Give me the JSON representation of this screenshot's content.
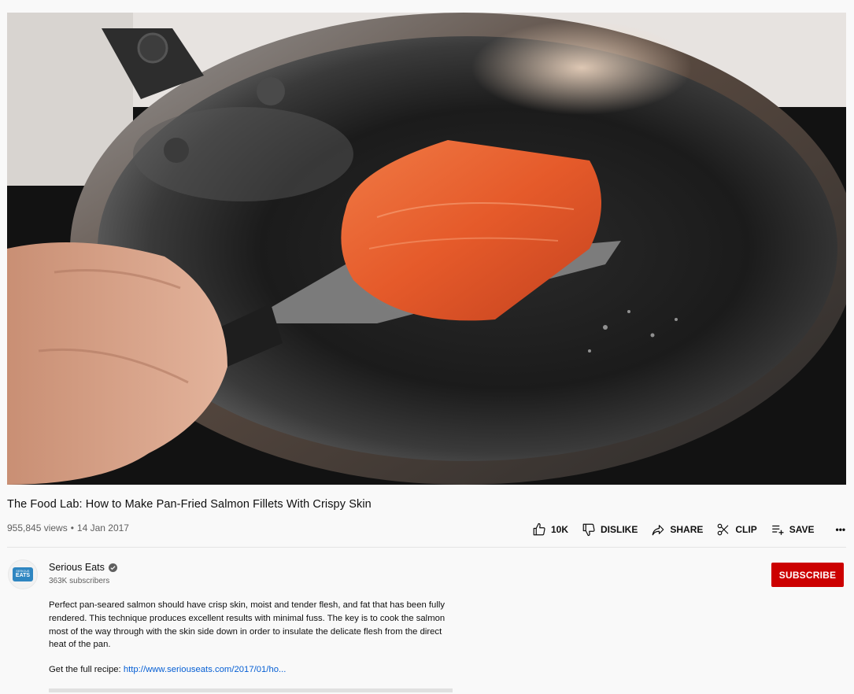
{
  "video": {
    "title": "The Food Lab: How to Make Pan-Fried Salmon Fillets With Crispy Skin",
    "views": "955,845 views",
    "separator": "•",
    "date": "14 Jan 2017"
  },
  "actions": {
    "like_count": "10K",
    "dislike_label": "DISLIKE",
    "share_label": "SHARE",
    "clip_label": "CLIP",
    "save_label": "SAVE",
    "more_label": "•••"
  },
  "channel": {
    "name": "Serious Eats",
    "subscribers": "363K subscribers",
    "avatar_text_top": "SERIOUS",
    "avatar_text_bottom": "EATS",
    "avatar_color": "#2f86c1"
  },
  "subscribe_label": "SUBSCRIBE",
  "description": {
    "text": "Perfect pan-seared salmon should have crisp skin, moist and tender flesh, and fat that has been fully rendered. This technique produces excellent results with minimal fuss. The key is to cook the salmon most of the way through with the skin side down in order to insulate the delicate flesh from the direct heat of the pan.",
    "recipe_prefix": "Get the full recipe: ",
    "recipe_link": "http://www.seriouseats.com/2017/01/ho..."
  },
  "colors": {
    "subscribe": "#cc0000",
    "link": "#065fd4",
    "muted": "#606060"
  }
}
